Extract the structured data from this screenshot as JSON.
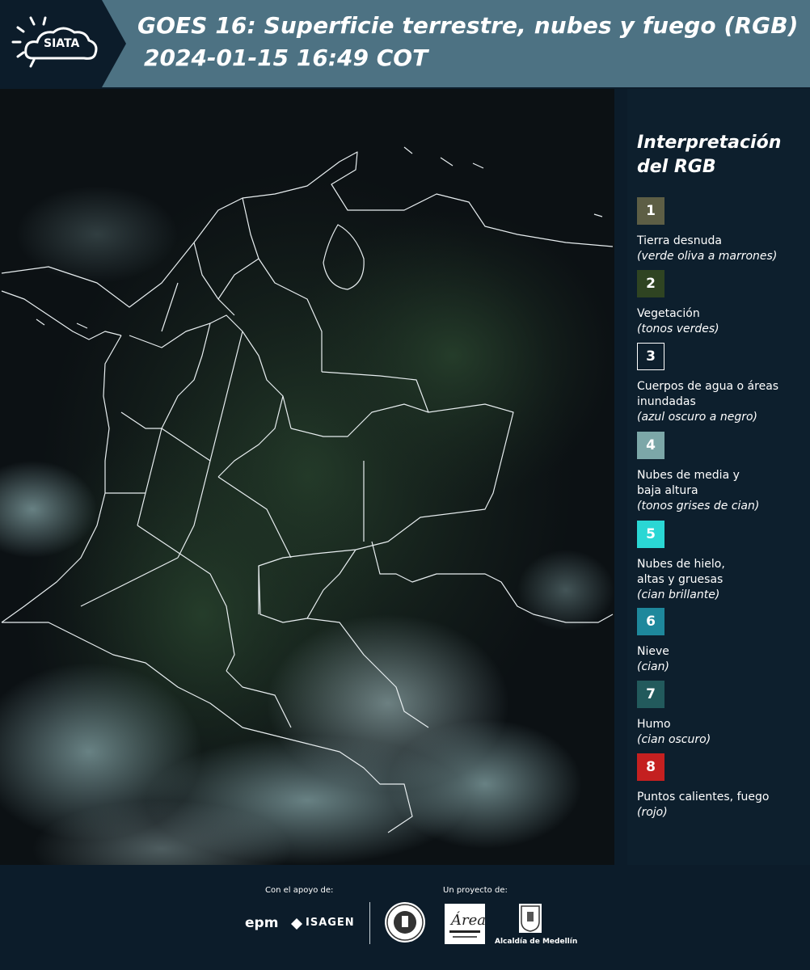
{
  "header": {
    "logo_text": "SIATA",
    "title_line1": "GOES 16: Superficie terrestre, nubes y fuego (RGB)",
    "title_line2": "2024-01-15 16:49 COT"
  },
  "legend": {
    "title": "Interpretación del RGB",
    "items": [
      {
        "num": "1",
        "label": "Tierra desnuda",
        "sub": "(verde oliva a marrones)",
        "color": "#5d5e45"
      },
      {
        "num": "2",
        "label": "Vegetación",
        "sub": "(tonos verdes)",
        "color": "#2f4422"
      },
      {
        "num": "3",
        "label": "Cuerpos de agua o áreas inundadas",
        "sub": "(azul oscuro a negro)",
        "color": "#0d1f2d"
      },
      {
        "num": "4",
        "label": "Nubes de media y baja altura",
        "sub": "(tonos grises de cian)",
        "color": "#7ca7a8"
      },
      {
        "num": "5",
        "label": "Nubes de hielo, altas y gruesas",
        "sub": "(cian brillante)",
        "color": "#2ad7d4"
      },
      {
        "num": "6",
        "label": "Nieve",
        "sub": "(cian)",
        "color": "#1e889c"
      },
      {
        "num": "7",
        "label": "Humo",
        "sub": "(cian oscuro)",
        "color": "#225a5c"
      },
      {
        "num": "8",
        "label": "Puntos calientes, fuego",
        "sub": "(rojo)",
        "color": "#c42020"
      }
    ]
  },
  "footer": {
    "support_label": "Con el apoyo de:",
    "project_label": "Un proyecto de:",
    "epm": "epm",
    "isagen": "ISAGEN",
    "alcaldia": "Alcaldía de Medellín",
    "area_logo_text": "Área METROPOLITANA Valle de Aburrá"
  }
}
